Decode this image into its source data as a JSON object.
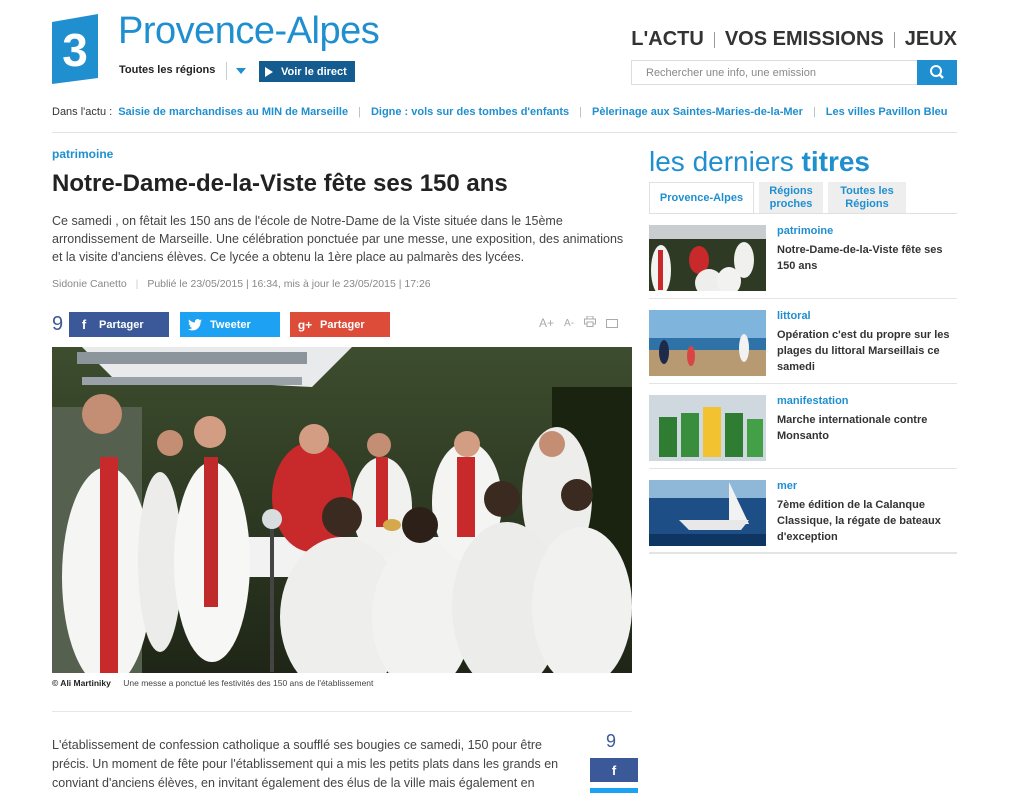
{
  "brand": {
    "channel_number": "3",
    "site_title": "Provence-Alpes"
  },
  "header": {
    "regions_label": "Toutes les régions",
    "live_label": "Voir le direct",
    "nav": [
      "L'ACTU",
      "VOS EMISSIONS",
      "JEUX"
    ],
    "search_placeholder": "Rechercher une info, une emission"
  },
  "actu_bar": {
    "label": "Dans l'actu :",
    "links": [
      "Saisie de marchandises au MIN de Marseille",
      "Digne : vols sur des tombes d'enfants",
      "Pèlerinage aux Saintes-Maries-de-la-Mer",
      "Les villes Pavillon Bleu"
    ]
  },
  "article": {
    "category": "patrimoine",
    "title": "Notre-Dame-de-la-Viste fête ses 150 ans",
    "lede": "Ce samedi , on fêtait les 150 ans de l'école de Notre-Dame de la Viste située dans le 15ème arrondissement de Marseille. Une célébration ponctuée par une messe, une exposition, des animations et la visite d'anciens élèves. Ce lycée a obtenu la 1ère place au palmarès des lycées.",
    "author": "Sidonie Canetto",
    "published": "Publié le 23/05/2015 | 16:34, mis à jour le 23/05/2015 | 17:26",
    "share_count": "9",
    "share_facebook": "Partager",
    "share_twitter": "Tweeter",
    "share_google": "Partager",
    "tool_increase": "A+",
    "tool_decrease": "A-",
    "photo_credit": "© Ali Martiniky",
    "photo_caption": "Une messe a ponctué les festivités des 150 ans de l'établissement",
    "body": "L'établissement de confession catholique a soufflé ses bougies ce samedi, 150 pour être précis. Un moment de fête pour l'établissement qui a mis les petits plats dans les grands en conviant d'anciens élèves, en invitant également des élus de la ville mais également en",
    "side_share_count": "9"
  },
  "sidebar": {
    "title_light": "les derniers",
    "title_bold": "titres",
    "tabs": [
      "Provence-Alpes",
      "Régions proches",
      "Toutes les Régions"
    ],
    "items": [
      {
        "category": "patrimoine",
        "title": "Notre-Dame-de-la-Viste fête ses 150 ans"
      },
      {
        "category": "littoral",
        "title": "Opération c'est du propre sur les plages du littoral Marseillais ce samedi"
      },
      {
        "category": "manifestation",
        "title": "Marche internationale contre Monsanto"
      },
      {
        "category": "mer",
        "title": "7ème édition de la Calanque Classique, la régate de bateaux d'exception"
      }
    ]
  },
  "colors": {
    "brand_blue": "#1f8fd0",
    "facebook": "#3b5998",
    "twitter": "#1da1f2",
    "google": "#dd4b39"
  }
}
